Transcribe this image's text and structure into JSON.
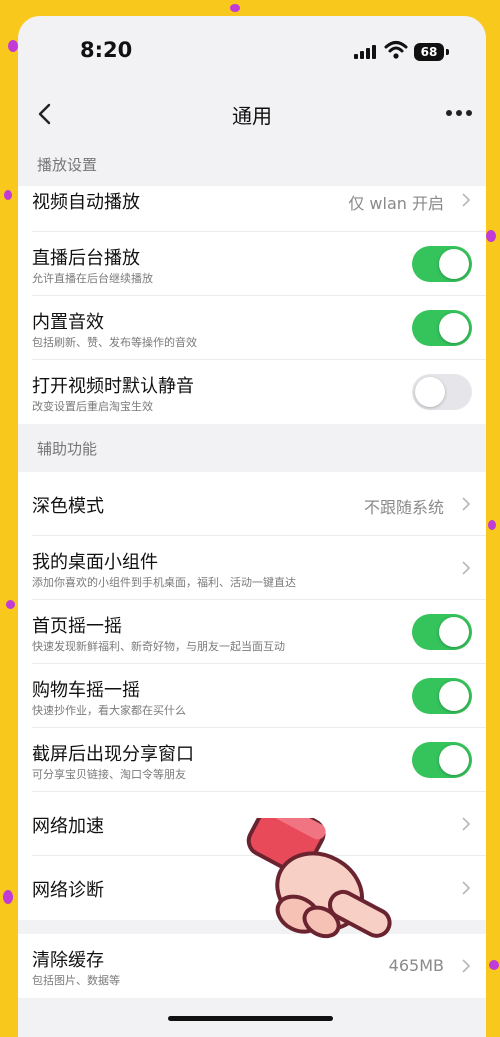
{
  "status_bar": {
    "time": "8:20",
    "battery": "68"
  },
  "nav": {
    "title": "通用"
  },
  "sections": {
    "playback_header": "播放设置",
    "assist_header": "辅助功能"
  },
  "rows": {
    "autoplay": {
      "title": "视频自动播放",
      "value": "仅 wlan 开启"
    },
    "live_bg": {
      "title": "直播后台播放",
      "sub": "允许直播在后台继续播放",
      "toggle": "on"
    },
    "sound_fx": {
      "title": "内置音效",
      "sub": "包括刷新、赞、发布等操作的音效",
      "toggle": "on"
    },
    "mute": {
      "title": "打开视频时默认静音",
      "sub": "改变设置后重启淘宝生效",
      "toggle": "off"
    },
    "dark_mode": {
      "title": "深色模式",
      "value": "不跟随系统"
    },
    "widget": {
      "title": "我的桌面小组件",
      "sub": "添加你喜欢的小组件到手机桌面，福利、活动一键直达"
    },
    "home_shake": {
      "title": "首页摇一摇",
      "sub": "快速发现新鲜福利、新奇好物，与朋友一起当面互动",
      "toggle": "on"
    },
    "cart_shake": {
      "title": "购物车摇一摇",
      "sub": "快速抄作业，看大家都在买什么",
      "toggle": "on"
    },
    "share_window": {
      "title": "截屏后出现分享窗口",
      "sub": "可分享宝贝链接、淘口令等朋友",
      "toggle": "on"
    },
    "net_accel": {
      "title": "网络加速"
    },
    "net_diag": {
      "title": "网络诊断"
    },
    "cache": {
      "title": "清除缓存",
      "sub": "包括图片、数据等",
      "value": "465MB"
    }
  },
  "colors": {
    "toggle_on": "#35c35b",
    "toggle_off": "#e6e6ea",
    "background": "#f8c81c",
    "decoration": "#c03bd8"
  },
  "icons": [
    "back-arrow-icon",
    "more-icon",
    "chevron-right-icon",
    "pointing-hand-icon",
    "wifi-icon",
    "signal-icon",
    "battery-icon"
  ]
}
